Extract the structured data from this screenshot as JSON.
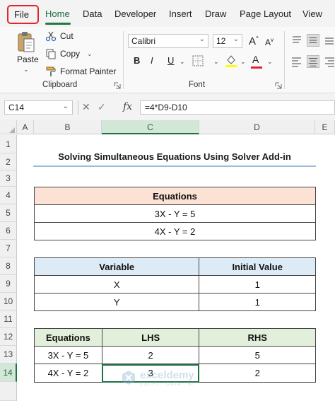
{
  "menu": {
    "file": "File",
    "tabs": [
      "Home",
      "Data",
      "Developer",
      "Insert",
      "Draw",
      "Page Layout",
      "View"
    ]
  },
  "ribbon": {
    "clipboard": {
      "paste": "Paste",
      "cut": "Cut",
      "copy": "Copy",
      "format_painter": "Format Painter",
      "label": "Clipboard"
    },
    "font": {
      "name": "Calibri",
      "size": "12",
      "label": "Font",
      "grow": "A",
      "shrink": "A",
      "bold": "B",
      "italic": "I",
      "underline": "U"
    }
  },
  "formula_bar": {
    "name_box": "C14",
    "formula": "=4*D9-D10",
    "fx": "fx"
  },
  "columns": [
    "A",
    "B",
    "C",
    "D",
    "E"
  ],
  "rows": [
    "1",
    "2",
    "3",
    "4",
    "5",
    "6",
    "7",
    "8",
    "9",
    "10",
    "11",
    "12",
    "13",
    "14"
  ],
  "sheet": {
    "title": "Solving Simultaneous Equations Using Solver Add-in",
    "equations_table": {
      "header": "Equations",
      "rows": [
        "3X - Y = 5",
        "4X - Y = 2"
      ]
    },
    "variables_table": {
      "headers": [
        "Variable",
        "Initial Value"
      ],
      "rows": [
        [
          "X",
          "1"
        ],
        [
          "Y",
          "1"
        ]
      ]
    },
    "results_table": {
      "headers": [
        "Equations",
        "LHS",
        "RHS"
      ],
      "rows": [
        [
          "3X - Y = 5",
          "2",
          "5"
        ],
        [
          "4X - Y = 2",
          "3",
          "2"
        ]
      ]
    }
  },
  "watermark": {
    "brand": "exceldemy",
    "tagline": "EXCEL · DATA · BI"
  },
  "colors": {
    "accent_green": "#217346",
    "file_outline": "#e0262d",
    "header_orange": "#fbe2d5",
    "header_blue": "#ddebf7",
    "header_green": "#e2efda"
  }
}
